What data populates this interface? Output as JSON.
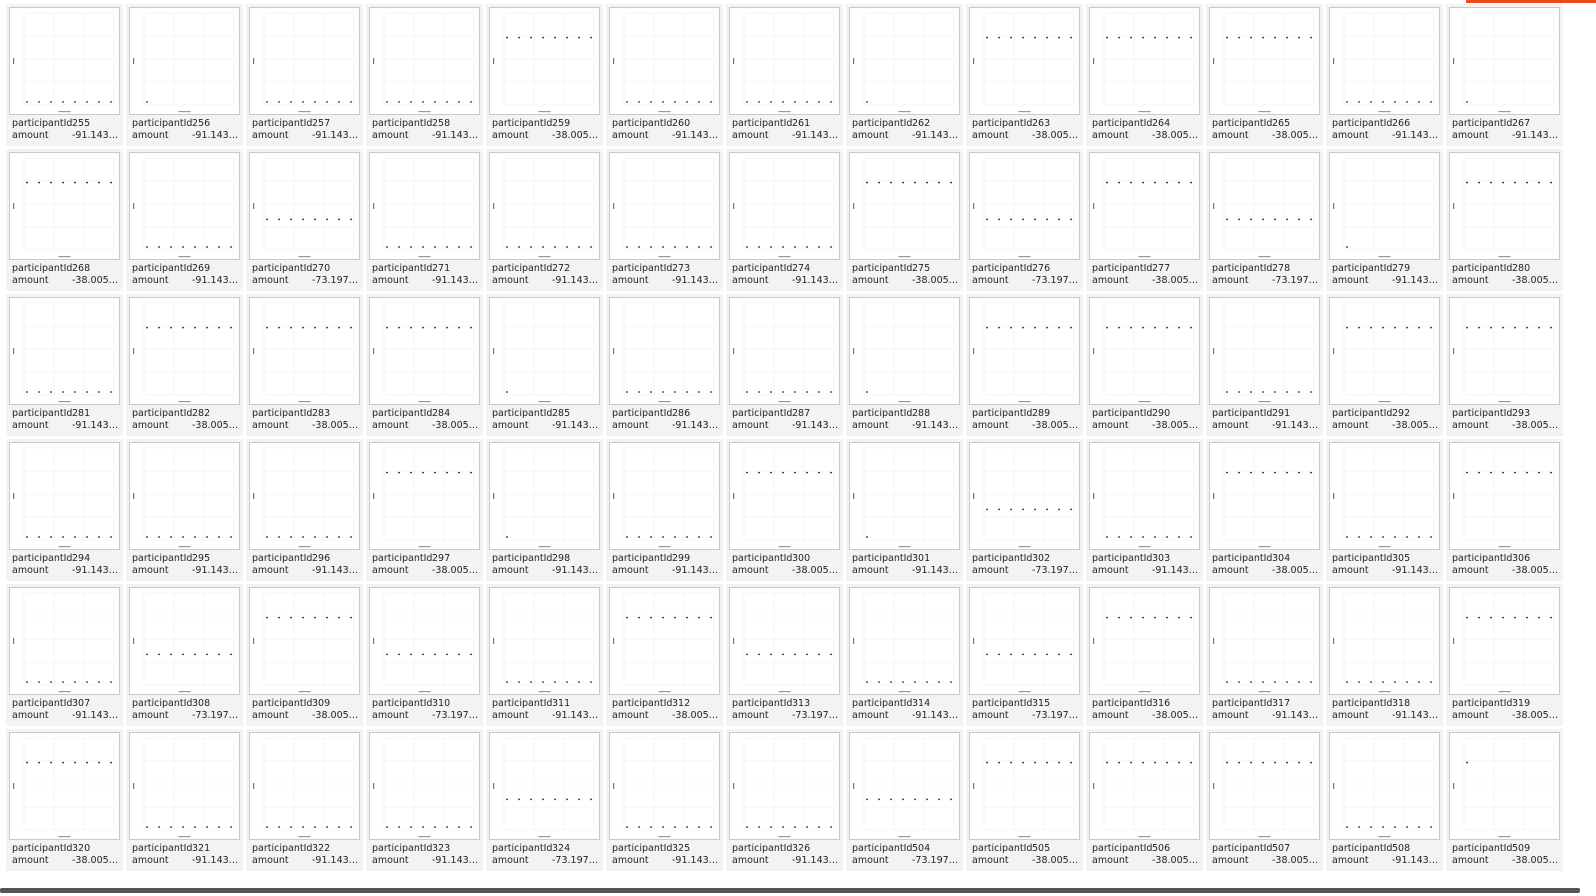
{
  "field_labels": {
    "id": "participantId",
    "amount": "amount"
  },
  "colors": {
    "accent": "#ee4a1d",
    "tile_bg": "#f3f3f3",
    "point": "#222222"
  },
  "plot_levels": {
    "-38.00537...": 0.7,
    "-73.19785...": 0.3,
    "-91.14351...": 0.0
  },
  "tiles": [
    {
      "id": "255",
      "amount": "-91.14351...",
      "points": 8
    },
    {
      "id": "256",
      "amount": "-91.14351...",
      "points": 1
    },
    {
      "id": "257",
      "amount": "-91.14351...",
      "points": 8
    },
    {
      "id": "258",
      "amount": "-91.14351...",
      "points": 8
    },
    {
      "id": "259",
      "amount": "-38.00537...",
      "points": 8
    },
    {
      "id": "260",
      "amount": "-91.14351...",
      "points": 8
    },
    {
      "id": "261",
      "amount": "-91.14351...",
      "points": 8
    },
    {
      "id": "262",
      "amount": "-91.14351...",
      "points": 1
    },
    {
      "id": "263",
      "amount": "-38.00537...",
      "points": 8
    },
    {
      "id": "264",
      "amount": "-38.00537...",
      "points": 8
    },
    {
      "id": "265",
      "amount": "-38.00537...",
      "points": 8
    },
    {
      "id": "266",
      "amount": "-91.14351...",
      "points": 8
    },
    {
      "id": "267",
      "amount": "-91.14351...",
      "points": 1
    },
    {
      "id": "268",
      "amount": "-38.00537...",
      "points": 8
    },
    {
      "id": "269",
      "amount": "-91.14351...",
      "points": 8
    },
    {
      "id": "270",
      "amount": "-73.19785...",
      "points": 8
    },
    {
      "id": "271",
      "amount": "-91.14351...",
      "points": 8
    },
    {
      "id": "272",
      "amount": "-91.14351...",
      "points": 8
    },
    {
      "id": "273",
      "amount": "-91.14351...",
      "points": 8
    },
    {
      "id": "274",
      "amount": "-91.14351...",
      "points": 8
    },
    {
      "id": "275",
      "amount": "-38.00537...",
      "points": 8
    },
    {
      "id": "276",
      "amount": "-73.19785...",
      "points": 8
    },
    {
      "id": "277",
      "amount": "-38.00537...",
      "points": 8
    },
    {
      "id": "278",
      "amount": "-73.19785...",
      "points": 8
    },
    {
      "id": "279",
      "amount": "-91.14351...",
      "points": 1
    },
    {
      "id": "280",
      "amount": "-38.00537...",
      "points": 8
    },
    {
      "id": "281",
      "amount": "-91.14351...",
      "points": 8
    },
    {
      "id": "282",
      "amount": "-38.00537...",
      "points": 8
    },
    {
      "id": "283",
      "amount": "-38.00537...",
      "points": 8
    },
    {
      "id": "284",
      "amount": "-38.00537...",
      "points": 8
    },
    {
      "id": "285",
      "amount": "-91.14351...",
      "points": 1
    },
    {
      "id": "286",
      "amount": "-91.14351...",
      "points": 8
    },
    {
      "id": "287",
      "amount": "-91.14351...",
      "points": 8
    },
    {
      "id": "288",
      "amount": "-91.14351...",
      "points": 1
    },
    {
      "id": "289",
      "amount": "-38.00537...",
      "points": 8
    },
    {
      "id": "290",
      "amount": "-38.00537...",
      "points": 8
    },
    {
      "id": "291",
      "amount": "-91.14351...",
      "points": 8
    },
    {
      "id": "292",
      "amount": "-38.00537...",
      "points": 8
    },
    {
      "id": "293",
      "amount": "-38.00537...",
      "points": 8
    },
    {
      "id": "294",
      "amount": "-91.14351...",
      "points": 8
    },
    {
      "id": "295",
      "amount": "-91.14351...",
      "points": 8
    },
    {
      "id": "296",
      "amount": "-91.14351...",
      "points": 8
    },
    {
      "id": "297",
      "amount": "-38.00537...",
      "points": 8
    },
    {
      "id": "298",
      "amount": "-91.14351...",
      "points": 1
    },
    {
      "id": "299",
      "amount": "-91.14351...",
      "points": 8
    },
    {
      "id": "300",
      "amount": "-38.00537...",
      "points": 8
    },
    {
      "id": "301",
      "amount": "-91.14351...",
      "points": 1
    },
    {
      "id": "302",
      "amount": "-73.19785...",
      "points": 8
    },
    {
      "id": "303",
      "amount": "-91.14351...",
      "points": 8
    },
    {
      "id": "304",
      "amount": "-38.00537...",
      "points": 8
    },
    {
      "id": "305",
      "amount": "-91.14351...",
      "points": 8
    },
    {
      "id": "306",
      "amount": "-38.00537...",
      "points": 8
    },
    {
      "id": "307",
      "amount": "-91.14351...",
      "points": 8
    },
    {
      "id": "308",
      "amount": "-73.19785...",
      "points": 8
    },
    {
      "id": "309",
      "amount": "-38.00537...",
      "points": 8
    },
    {
      "id": "310",
      "amount": "-73.19785...",
      "points": 8
    },
    {
      "id": "311",
      "amount": "-91.14351...",
      "points": 8
    },
    {
      "id": "312",
      "amount": "-38.00537...",
      "points": 8
    },
    {
      "id": "313",
      "amount": "-73.19785...",
      "points": 8
    },
    {
      "id": "314",
      "amount": "-91.14351...",
      "points": 8
    },
    {
      "id": "315",
      "amount": "-73.19785...",
      "points": 8
    },
    {
      "id": "316",
      "amount": "-38.00537...",
      "points": 8
    },
    {
      "id": "317",
      "amount": "-91.14351...",
      "points": 8
    },
    {
      "id": "318",
      "amount": "-91.14351...",
      "points": 8
    },
    {
      "id": "319",
      "amount": "-38.00537...",
      "points": 8
    },
    {
      "id": "320",
      "amount": "-38.00537...",
      "points": 8
    },
    {
      "id": "321",
      "amount": "-91.14351...",
      "points": 8
    },
    {
      "id": "322",
      "amount": "-91.14351...",
      "points": 8
    },
    {
      "id": "323",
      "amount": "-91.14351...",
      "points": 8
    },
    {
      "id": "324",
      "amount": "-73.19785...",
      "points": 8
    },
    {
      "id": "325",
      "amount": "-91.14351...",
      "points": 8
    },
    {
      "id": "326",
      "amount": "-91.14351...",
      "points": 8
    },
    {
      "id": "504",
      "amount": "-73.19785...",
      "points": 8
    },
    {
      "id": "505",
      "amount": "-38.00537...",
      "points": 8
    },
    {
      "id": "506",
      "amount": "-38.00537...",
      "points": 8
    },
    {
      "id": "507",
      "amount": "-38.00537...",
      "points": 8
    },
    {
      "id": "508",
      "amount": "-91.14351...",
      "points": 8
    },
    {
      "id": "509",
      "amount": "-38.00537...",
      "points": 1
    }
  ]
}
